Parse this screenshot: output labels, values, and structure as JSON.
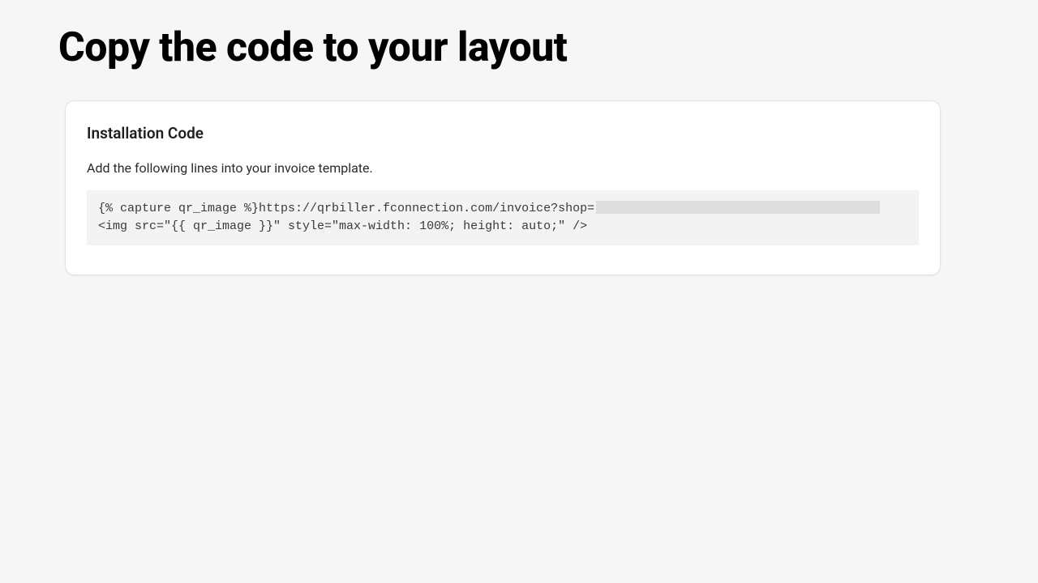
{
  "page": {
    "title": "Copy the code to your layout"
  },
  "card": {
    "title": "Installation Code",
    "instructions": "Add the following lines into your invoice template.",
    "code": {
      "line1_prefix": "{% capture qr_image %}https://qrbiller.fconnection.com/invoice?shop=",
      "line2": "<img src=\"{{ qr_image }}\" style=\"max-width: 100%; height: auto;\" />"
    }
  }
}
